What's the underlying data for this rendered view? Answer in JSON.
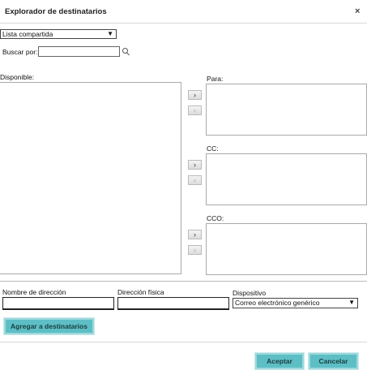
{
  "dialog": {
    "title": "Explorador de destinatarios",
    "close": "×"
  },
  "list_select": {
    "value": "Lista compartida"
  },
  "search": {
    "label": "Buscar por:",
    "value": ""
  },
  "available": {
    "label": "Disponible:"
  },
  "to": {
    "label": "Para:"
  },
  "cc": {
    "label": "CC:"
  },
  "bcc": {
    "label": "CCO:"
  },
  "arrows": {
    "add": "›",
    "remove": "‹"
  },
  "form": {
    "name_label": "Nombre de dirección",
    "physical_label": "Dirección física",
    "device_label": "Dispositivo",
    "device_value": "Correo electrónico genérico",
    "add_button": "Agregar a destinatarios"
  },
  "footer": {
    "ok": "Aceptar",
    "cancel": "Cancelar"
  },
  "colors": {
    "accent": "#5dbfc5"
  }
}
